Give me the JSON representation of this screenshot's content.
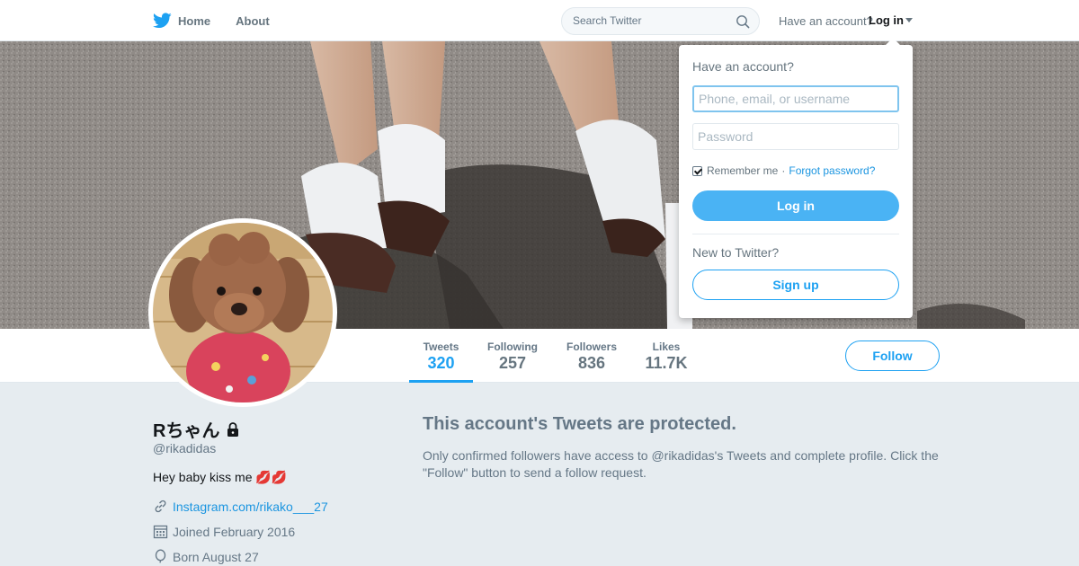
{
  "nav": {
    "home_label": "Home",
    "about_label": "About",
    "search_placeholder": "Search Twitter",
    "account_prompt": "Have an account?",
    "login_label": "Log in"
  },
  "profile": {
    "name": "Rちゃん",
    "handle": "@rikadidas",
    "bio": "Hey baby kiss me 💋💋",
    "website": "Instagram.com/rikako___27",
    "joined": "Joined February 2016",
    "born": "Born August 27"
  },
  "stats": [
    {
      "label": "Tweets",
      "value": "320"
    },
    {
      "label": "Following",
      "value": "257"
    },
    {
      "label": "Followers",
      "value": "836"
    },
    {
      "label": "Likes",
      "value": "11.7K"
    }
  ],
  "follow_label": "Follow",
  "protected": {
    "title": "This account's Tweets are protected.",
    "text": "Only confirmed followers have access to @rikadidas's Tweets and complete profile. Click the \"Follow\" button to send a follow request."
  },
  "login_dropdown": {
    "heading": "Have an account?",
    "username_placeholder": "Phone, email, or username",
    "password_placeholder": "Password",
    "remember_label": "Remember me",
    "separator": "·",
    "forgot_label": "Forgot password?",
    "login_button": "Log in",
    "new_prompt": "New to Twitter?",
    "signup_button": "Sign up"
  },
  "colors": {
    "accent": "#1da1f2",
    "login_button": "#4ab3f4",
    "background": "#e6ecf0"
  }
}
